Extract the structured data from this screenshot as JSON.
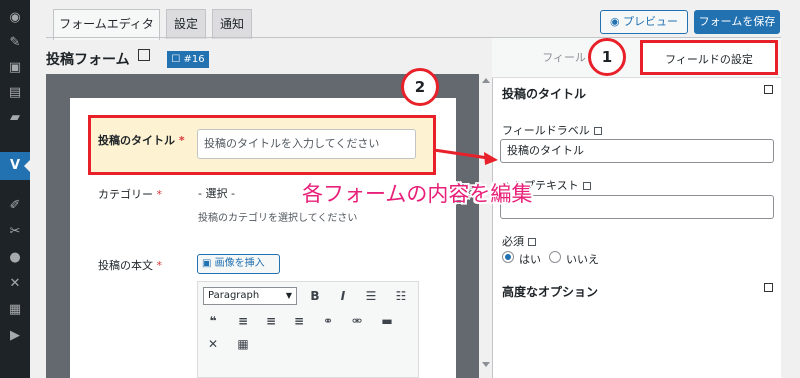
{
  "tabs": [
    {
      "label": "フォームエディタ",
      "active": true
    },
    {
      "label": "設定",
      "active": false
    },
    {
      "label": "通知",
      "active": false
    }
  ],
  "header": {
    "form_title": "投稿フォーム",
    "form_id": "☐ #16",
    "preview_label": "プレビュー",
    "save_label": "フォームを保存"
  },
  "editor": {
    "title_field": {
      "label": "投稿のタイトル",
      "required_mark": "*",
      "placeholder": "投稿のタイトルを入力してください"
    },
    "category_field": {
      "label": "カテゴリー",
      "required_mark": "*",
      "selected": "- 選択 -",
      "help": "投稿のカテゴリを選択してください"
    },
    "body_field": {
      "label": "投稿の本文",
      "required_mark": "*",
      "media_button": "画像を挿入"
    },
    "format_select": "Paragraph"
  },
  "panel": {
    "inactive_tab": "フィールドを",
    "active_tab": "フィールドの設定",
    "section_title": "投稿のタイトル",
    "field_label_label": "フィールドラベル",
    "field_label_value": "投稿のタイトル",
    "help_text_label": "ヘルプテキスト",
    "help_text_value": "",
    "required_label": "必須",
    "required_options": [
      "はい",
      "いいえ"
    ],
    "required_selected": "はい",
    "advanced_title": "高度なオプション"
  },
  "annotations": {
    "badge1": "1",
    "badge2": "2",
    "callout": "各フォームの内容を編集"
  },
  "colors": {
    "accent": "#2271b1",
    "annotation_red": "#e8202a",
    "callout_pink": "#e8207a",
    "highlight_row": "#fdf2d1"
  }
}
